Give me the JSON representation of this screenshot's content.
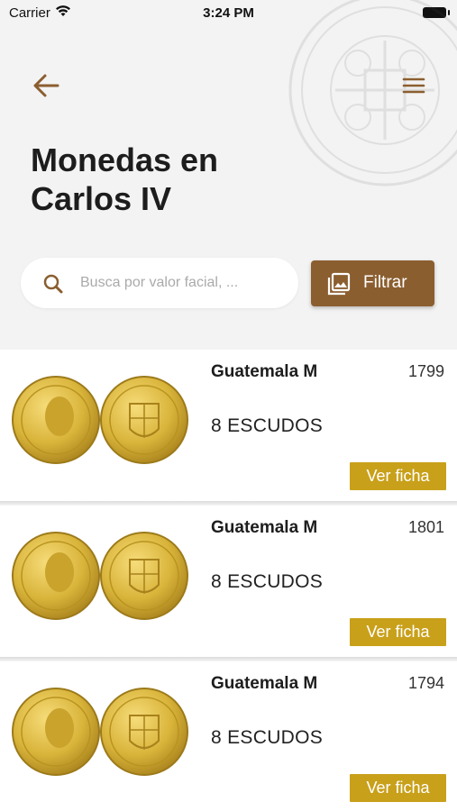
{
  "status_bar": {
    "carrier": "Carrier",
    "time": "3:24 PM"
  },
  "header": {
    "title": "Monedas en Carlos IV"
  },
  "search": {
    "placeholder": "Busca por valor facial, ..."
  },
  "filter": {
    "label": "Filtrar"
  },
  "colors": {
    "brand_brown": "#8b5e2f",
    "gold_button": "#c9a01a",
    "coin_gold": "#d9b43a"
  },
  "coins": [
    {
      "mint": "Guatemala M",
      "year": "1799",
      "value": "8 ESCUDOS",
      "button": "Ver ficha"
    },
    {
      "mint": "Guatemala M",
      "year": "1801",
      "value": "8 ESCUDOS",
      "button": "Ver ficha"
    },
    {
      "mint": "Guatemala M",
      "year": "1794",
      "value": "8 ESCUDOS",
      "button": "Ver ficha"
    }
  ]
}
